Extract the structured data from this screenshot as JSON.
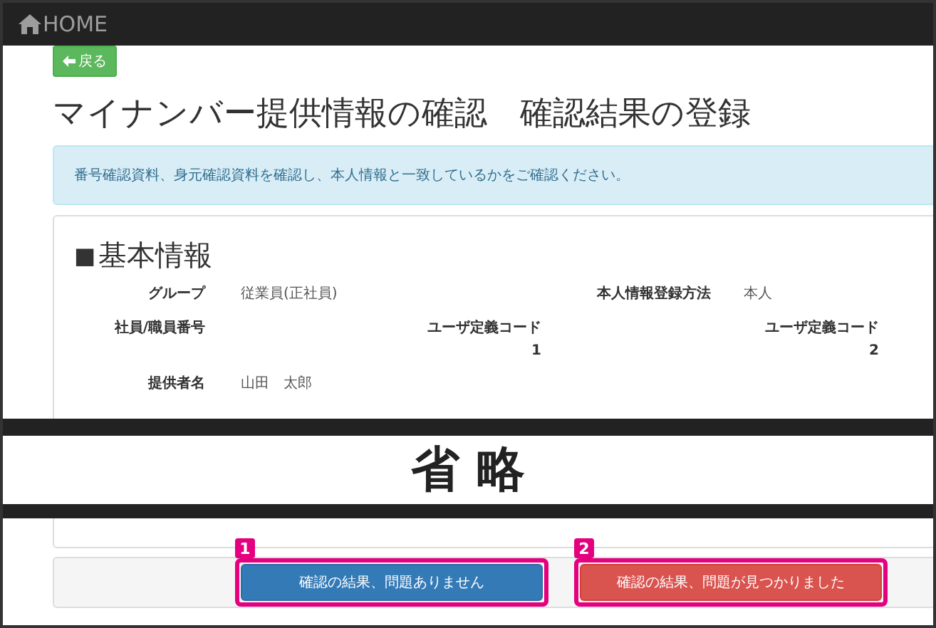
{
  "navbar": {
    "home": "HOME"
  },
  "back_button": "戻る",
  "title": "マイナンバー提供情報の確認　確認結果の登録",
  "alert": "番号確認資料、身元確認資料を確認し、本人情報と一致しているかをご確認ください。",
  "section": {
    "marker": "■",
    "title": "基本情報"
  },
  "rows": [
    {
      "items": [
        {
          "kind": "pair",
          "label": "グループ",
          "value": "従業員(正社員)"
        },
        {
          "kind": "pair",
          "label": "本人情報登録方法",
          "value": "本人"
        }
      ]
    },
    {
      "items": [
        {
          "kind": "label",
          "label": "社員/職員番号"
        },
        {
          "kind": "code",
          "label": "ユーザ定義コード",
          "value": "1"
        },
        {
          "kind": "code",
          "label": "ユーザ定義コード",
          "value": "2"
        }
      ]
    },
    {
      "items": [
        {
          "kind": "pair",
          "label": "提供者名",
          "value": "山田　太郎"
        }
      ]
    }
  ],
  "omission": "省 略",
  "actions": [
    {
      "number": "1",
      "label": "確認の結果、問題ありません",
      "kind": "primary"
    },
    {
      "number": "2",
      "label": "確認の結果、問題が見つかりました",
      "kind": "danger"
    }
  ]
}
